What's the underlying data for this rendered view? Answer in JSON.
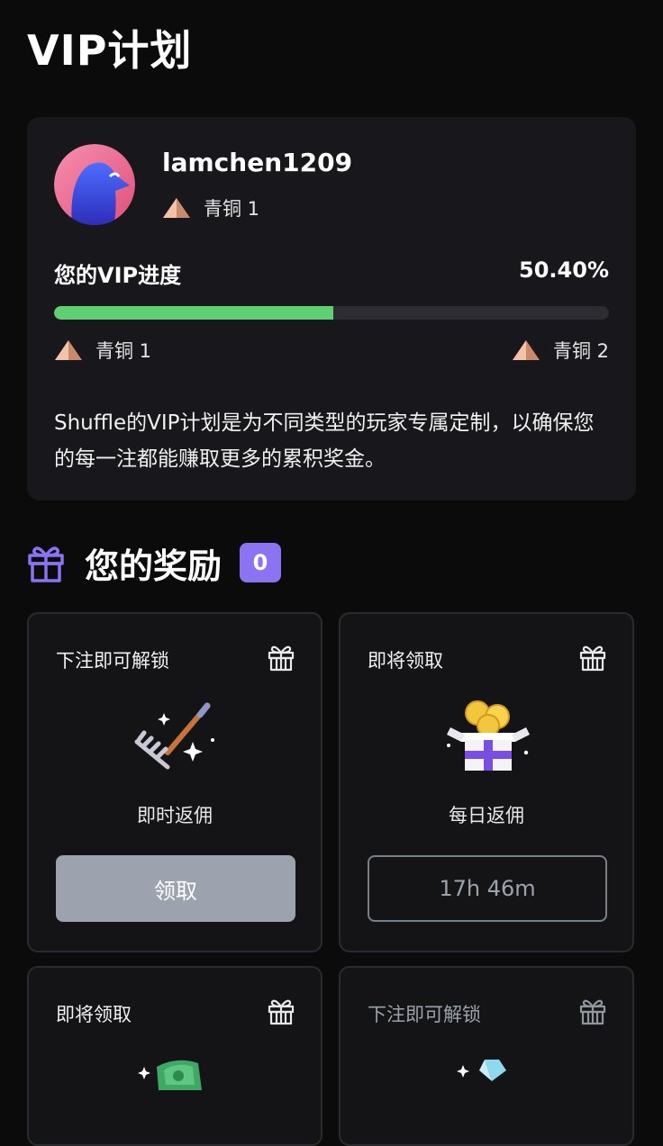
{
  "page": {
    "title": "VIP计划"
  },
  "profile": {
    "username": "lamchen1209",
    "current_tier": "青铜 1"
  },
  "progress": {
    "label": "您的VIP进度",
    "percent_text": "50.40%",
    "value": 0.504,
    "from_tier": "青铜 1",
    "to_tier": "青铜 2",
    "fill_color": "#5fcf74"
  },
  "description": "Shuffle的VIP计划是为不同类型的玩家专属定制，以确保您的每一注都能赚取更多的累积奖金。",
  "rewards": {
    "title": "您的奖励",
    "count": "0",
    "accent": "#8b73f2",
    "cards": [
      {
        "status": "下注即可解锁",
        "name": "即时返佣",
        "action": "领取",
        "icon": "rake-icon"
      },
      {
        "status": "即将领取",
        "name": "每日返佣",
        "timer": "17h 46m",
        "icon": "gift-box-coins-icon"
      },
      {
        "status": "即将领取",
        "icon": "cash-icon"
      },
      {
        "status": "下注即可解锁",
        "icon": "diamond-icon"
      }
    ]
  }
}
